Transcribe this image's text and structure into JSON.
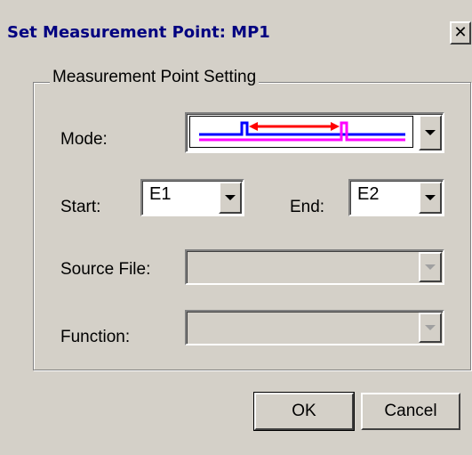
{
  "window": {
    "title": "Set Measurement Point: MP1",
    "close_glyph": "✕"
  },
  "group": {
    "label": "Measurement Point Setting"
  },
  "mode": {
    "label": "Mode:",
    "selected_icon": "pulse-interval-waveform-icon",
    "colors": {
      "baseline_blue": "#0000ff",
      "baseline_magenta": "#ff00ff",
      "interval_red": "#ff0000"
    }
  },
  "start": {
    "label": "Start:",
    "value": "E1"
  },
  "end": {
    "label": "End:",
    "value": "E2"
  },
  "source_file": {
    "label": "Source File:",
    "value": "",
    "enabled": false
  },
  "function": {
    "label": "Function:",
    "value": "",
    "enabled": false
  },
  "buttons": {
    "ok": "OK",
    "cancel": "Cancel"
  }
}
